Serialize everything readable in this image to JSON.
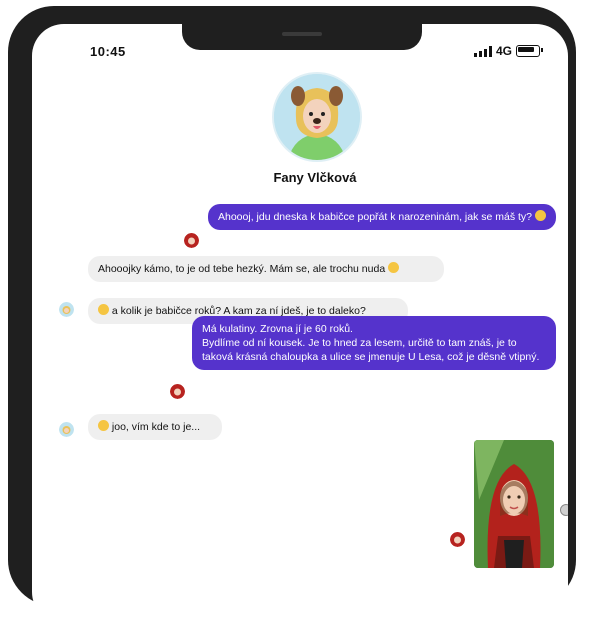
{
  "status_bar": {
    "time": "10:45",
    "network": "4G"
  },
  "contact": {
    "name": "Fany Vlčková"
  },
  "messages": [
    {
      "direction": "outgoing",
      "text": "Ahoooj, jdu dneska k babičce popřát k narozeninám, jak se máš ty?",
      "emoji": "smile"
    },
    {
      "direction": "incoming",
      "text": "Ahooojky kámo, to je od tebe hezký. Mám se, ale trochu nuda",
      "emoji": "bored"
    },
    {
      "direction": "incoming",
      "text": "a kolik je babičce roků? A kam za ní jdeš, je to daleko?",
      "emoji": "smile"
    },
    {
      "direction": "outgoing",
      "line1": "Má kulatiny. Zrovna jí je 60 roků.",
      "line2": "Bydlíme od ní kousek. Je to hned za lesem, určitě to tam znáš, je to taková krásná chaloupka a ulice se jmenuje U Lesa, což je děsně vtipný."
    },
    {
      "direction": "incoming",
      "text": "joo, vím kde to je...",
      "emoji": "smile"
    },
    {
      "direction": "outgoing",
      "type": "image",
      "description": "girl-in-red-hood-photo"
    }
  ],
  "colors": {
    "outgoing_bubble": "#5533cc",
    "incoming_bubble": "#efefef",
    "frame": "#1f1f1f"
  }
}
